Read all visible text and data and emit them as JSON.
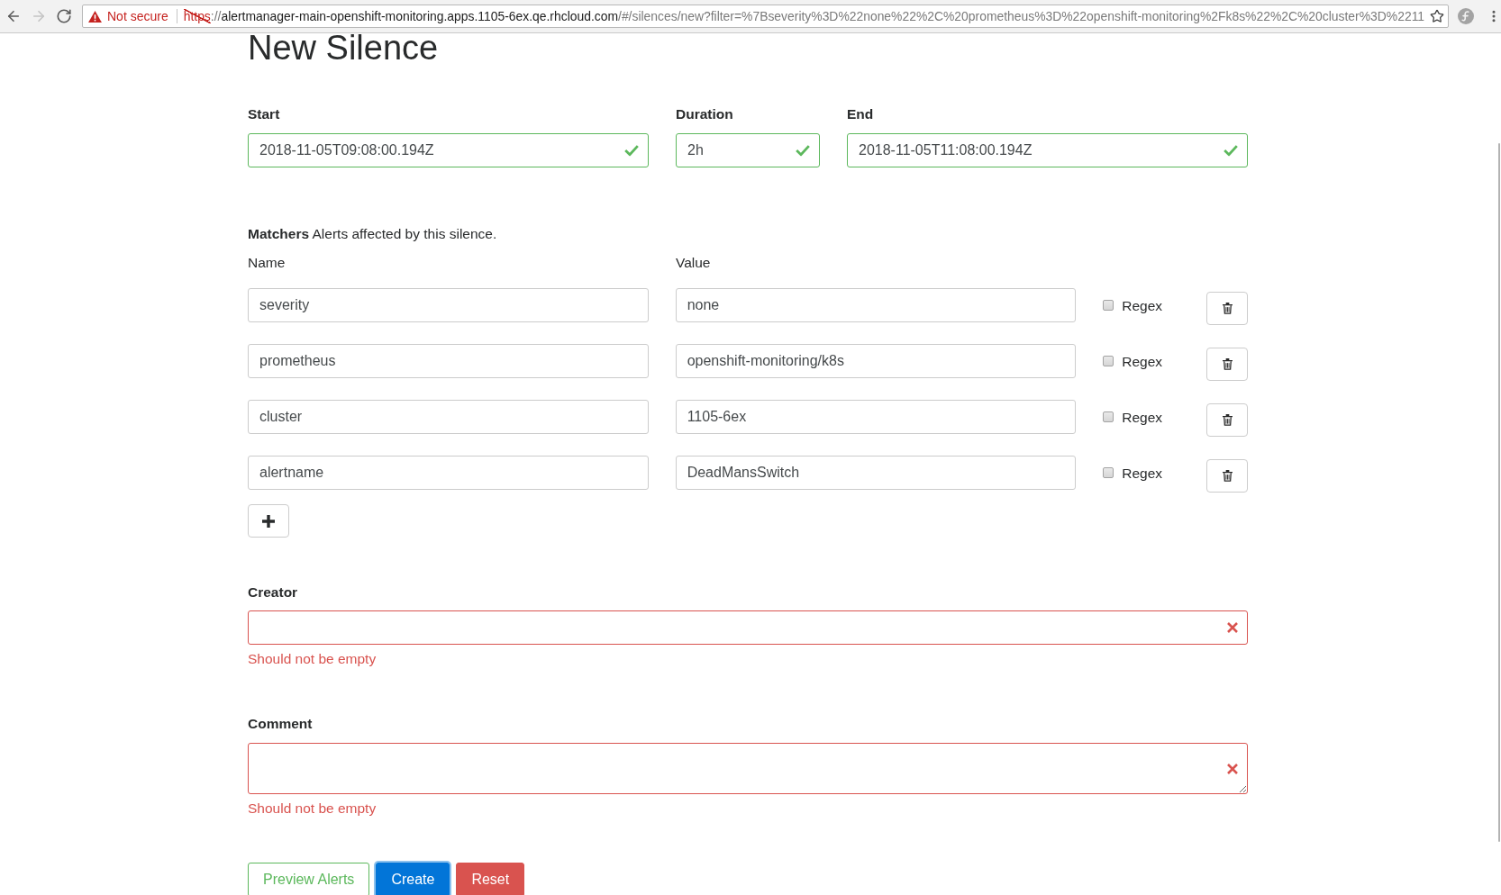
{
  "browser": {
    "nav_buttons": [
      {
        "kind": "back",
        "disabled": false
      },
      {
        "kind": "forward",
        "disabled": true
      },
      {
        "kind": "reload",
        "disabled": false
      }
    ],
    "security_label": "Not secure",
    "url_parts": [
      {
        "kind": "scheme",
        "text": "https"
      },
      {
        "kind": "plain",
        "text": "://"
      },
      {
        "kind": "host",
        "text": "alertmanager-main-openshift-monitoring.apps.1105-6ex.qe.rhcloud.com"
      },
      {
        "kind": "plain",
        "text": "/#/silences/new?filter=%7Bseverity%3D%22none%22%2C%20prometheus%3D%22openshift-monitoring%2Fk8s%22%2C%20cluster%3D%2211"
      }
    ]
  },
  "page": {
    "title": "New Silence",
    "time_fields": [
      {
        "label": "Start",
        "value": "2018-11-05T09:08:00.194Z",
        "valid": true
      },
      {
        "label": "Duration",
        "value": "2h",
        "valid": true
      },
      {
        "label": "End",
        "value": "2018-11-05T11:08:00.194Z",
        "valid": true
      }
    ],
    "matchers": {
      "caption": "**Matchers** Alerts affected by this silence.",
      "name_header": "Name",
      "value_header": "Value",
      "rows": [
        {
          "name": "severity",
          "value": "none",
          "regex": {
            "label": "Regex",
            "checked": false
          }
        },
        {
          "name": "prometheus",
          "value": "openshift-monitoring/k8s",
          "regex": {
            "label": "Regex",
            "checked": false
          }
        },
        {
          "name": "cluster",
          "value": "1105-6ex",
          "regex": {
            "label": "Regex",
            "checked": false
          }
        },
        {
          "name": "alertname",
          "value": "DeadMansSwitch",
          "regex": {
            "label": "Regex",
            "checked": false
          }
        }
      ]
    },
    "creator": {
      "label": "Creator",
      "valid": false,
      "error": "Should not be empty"
    },
    "comment": {
      "label": "Comment",
      "valid": false,
      "error": "Should not be empty"
    },
    "buttons": [
      {
        "label": "Preview Alerts",
        "kind": "outline-success",
        "focused": false
      },
      {
        "label": "Create",
        "kind": "primary",
        "focused": true
      },
      {
        "label": "Reset",
        "kind": "danger",
        "focused": false
      }
    ]
  }
}
